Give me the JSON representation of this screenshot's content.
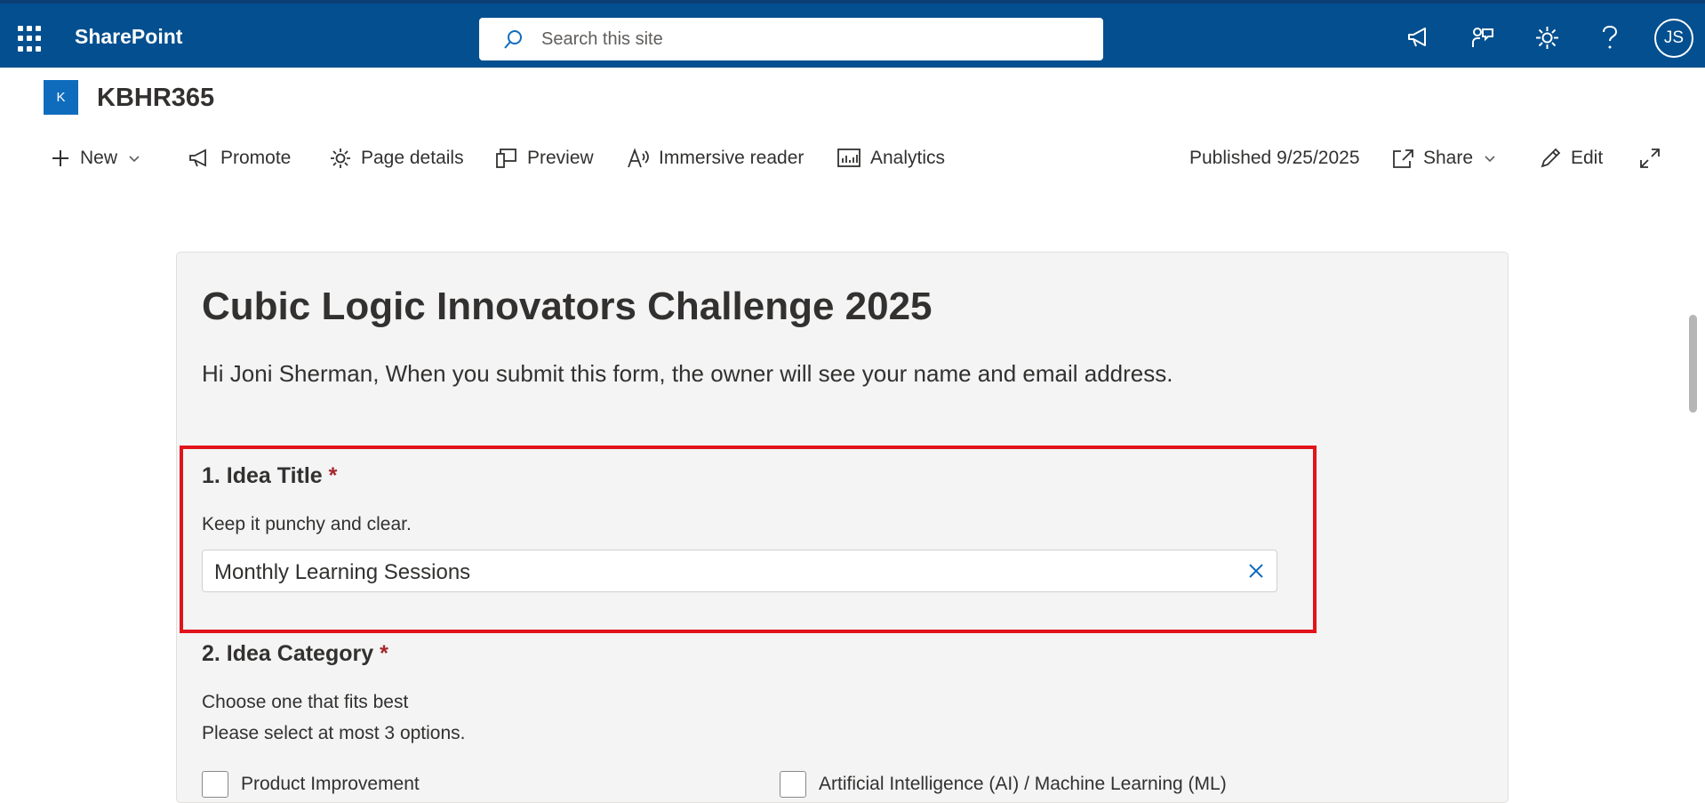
{
  "app": {
    "name": "SharePoint",
    "search_placeholder": "Search this site",
    "user_initials": "JS",
    "accent": "#034f8f"
  },
  "site": {
    "logo_letter": "K",
    "title": "KBHR365"
  },
  "commandbar": {
    "new": "New",
    "promote": "Promote",
    "page_details": "Page details",
    "preview": "Preview",
    "immersive_reader": "Immersive reader",
    "analytics": "Analytics",
    "published": "Published 9/25/2025",
    "share": "Share",
    "edit": "Edit"
  },
  "form": {
    "title": "Cubic Logic Innovators Challenge 2025",
    "description": "Hi Joni Sherman, When you submit this form, the owner will see your name and email address.",
    "questions": [
      {
        "number_title": "1. Idea Title",
        "required_mark": "*",
        "help": "Keep it punchy and clear.",
        "answer": "Monthly Learning Sessions"
      },
      {
        "number_title": "2. Idea Category",
        "required_mark": "*",
        "help": "Choose one that fits best",
        "limit": "Please select at most 3 options.",
        "options": [
          "Product Improvement",
          "Artificial Intelligence (AI) / Machine Learning (ML)"
        ]
      }
    ]
  },
  "icons": {
    "waffle": "app-launcher-icon",
    "search": "search-icon",
    "megaphone": "megaphone-icon",
    "feedback": "feedback-icon",
    "settings": "gear-icon",
    "help": "help-icon",
    "expand": "expand-icon",
    "clear": "close-icon"
  }
}
